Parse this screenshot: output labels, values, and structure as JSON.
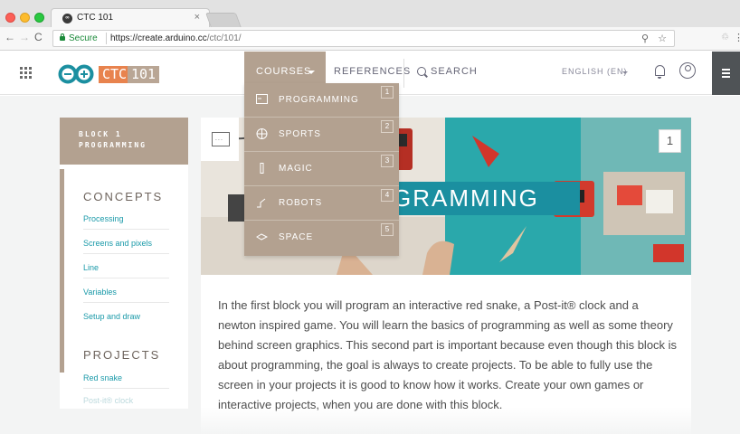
{
  "browser": {
    "tab_title": "CTC 101",
    "tab_close": "×",
    "secure_label": "Secure",
    "url_host": "https://create.arduino.cc",
    "url_path": "/ctc/101/",
    "nav_back": "←",
    "nav_forward": "→",
    "nav_reload": "C",
    "zoom_icon": "⚲",
    "bookmark_star": "☆",
    "extension_icon": "♲",
    "menu_icon": "⋮"
  },
  "header": {
    "logo_ctc": "CTC",
    "logo_101": "101",
    "courses_label": "COURSES",
    "references_label": "REFERENCES",
    "search_label": "SEARCH",
    "language_label": "ENGLISH (EN)",
    "accent_color": "#b3a190"
  },
  "dropdown": {
    "items": [
      {
        "label": "PROGRAMMING",
        "number": "1",
        "icon": "monitor-icon"
      },
      {
        "label": "SPORTS",
        "number": "2",
        "icon": "ball-icon"
      },
      {
        "label": "MAGIC",
        "number": "3",
        "icon": "wand-icon"
      },
      {
        "label": "ROBOTS",
        "number": "4",
        "icon": "robot-arm-icon"
      },
      {
        "label": "SPACE",
        "number": "5",
        "icon": "rocket-icon"
      }
    ]
  },
  "sidebar": {
    "block_line1": "BLOCK 1",
    "block_line2": "PROGRAMMING",
    "concepts_heading": "CONCEPTS",
    "concepts": [
      "Processing",
      "Screens and pixels",
      "Line",
      "Variables",
      "Setup and draw"
    ],
    "projects_heading": "PROJECTS",
    "projects": [
      "Red snake",
      "Post-it® clock"
    ]
  },
  "hero": {
    "title_fragment": "GRAMMING",
    "badge": "1"
  },
  "content": {
    "intro": "In the first block you will program an interactive red snake, a Post-it® clock and a newton inspired game. You will learn the basics of programming as well as some theory behind screen graphics. This second part is important because even though this block is about programming, the goal is always to create projects. To be able to fully use the screen in your projects it is good to know how it works. Create your own games or interactive projects, when you are done with this block."
  }
}
